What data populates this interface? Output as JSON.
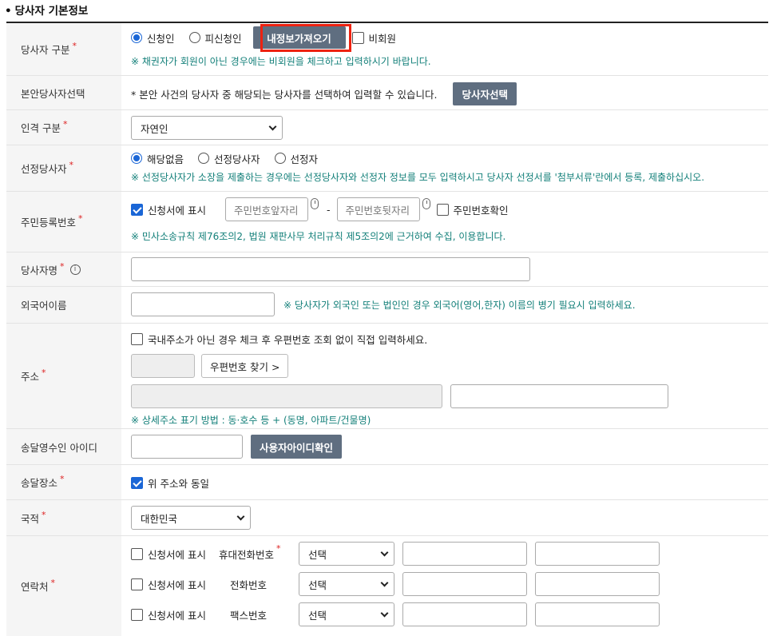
{
  "section": {
    "bullet": "•",
    "title": "당사자 기본정보"
  },
  "required_mark": "*",
  "rows": {
    "party_type": {
      "label": "당사자 구분",
      "options": [
        "신청인",
        "피신청인"
      ],
      "selected": "신청인",
      "load_button": "내정보가져오기",
      "nonmember_label": "비회원",
      "note": "※ 채권자가 회원이 아닌 경우에는 비회원을 체크하고 입력하시기 바랍니다."
    },
    "case_party": {
      "label": "본안당사자선택",
      "text": "* 본안 사건의 당사자 중 해당되는 당사자를 선택하여 입력할 수 있습니다.",
      "button": "당사자선택"
    },
    "person_type": {
      "label": "인격 구분",
      "value": "자연인"
    },
    "appointed": {
      "label": "선정당사자",
      "options": [
        "해당없음",
        "선정당사자",
        "선정자"
      ],
      "selected": "해당없음",
      "note": "※ 선정당사자가 소장을 제출하는 경우에는 선정당사자와 선정자 정보를 모두 입력하시고 당사자 선정서를 '첨부서류'란에서 등록, 제출하십시오."
    },
    "resident_no": {
      "label": "주민등록번호",
      "show_label": "신청서에 표시",
      "show_checked": true,
      "front_placeholder": "주민번호앞자리",
      "dash": "-",
      "back_placeholder": "주민번호뒷자리",
      "confirm_label": "주민번호확인",
      "note": "※ 민사소송규칙 제76조의2, 법원 재판사무 처리규칙 제5조의2에 근거하여 수집, 이용합니다."
    },
    "party_name": {
      "label": "당사자명",
      "info": "i"
    },
    "foreign_name": {
      "label": "외국어이름",
      "note": "※ 당사자가 외국인 또는 법인인 경우 외국어(영어,한자) 이름의 병기 필요시 입력하세요."
    },
    "address": {
      "label": "주소",
      "foreign_check": "국내주소가 아닌 경우 체크 후 우편번호 조회 없이 직접 입력하세요.",
      "zip_button": "우편번호 찾기 >",
      "note": "※ 상세주소 표기 방법 : 동·호수 등 + (동명, 아파트/건물명)"
    },
    "receiver_id": {
      "label": "송달영수인 아이디",
      "button": "사용자아이디확인"
    },
    "delivery_place": {
      "label": "송달장소",
      "same_label": "위 주소와 동일",
      "checked": true
    },
    "nationality": {
      "label": "국적",
      "value": "대한민국"
    },
    "contact": {
      "label": "연락처",
      "lines": [
        {
          "show_label": "신청서에 표시",
          "type": "휴대전화번호",
          "required": true,
          "select": "선택"
        },
        {
          "show_label": "신청서에 표시",
          "type": "전화번호",
          "required": false,
          "select": "선택"
        },
        {
          "show_label": "신청서에 표시",
          "type": "팩스번호",
          "required": false,
          "select": "선택"
        }
      ]
    }
  }
}
